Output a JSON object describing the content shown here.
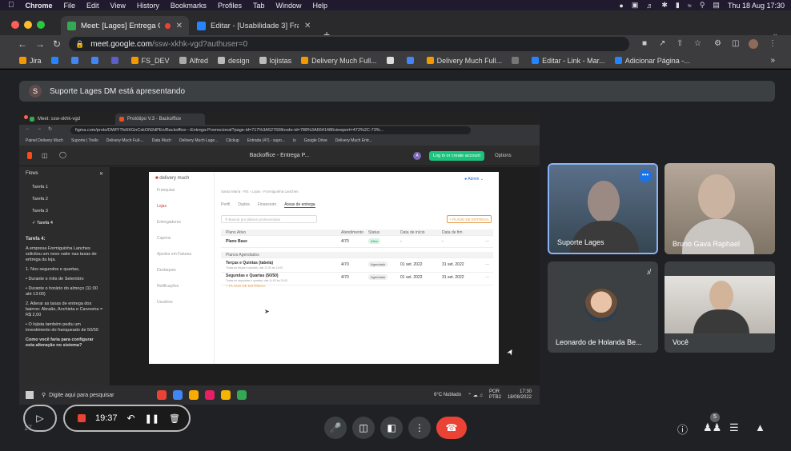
{
  "menubar": {
    "app": "Chrome",
    "items": [
      "File",
      "Edit",
      "View",
      "History",
      "Bookmarks",
      "Profiles",
      "Tab",
      "Window",
      "Help"
    ],
    "clock": "Thu 18 Aug  17:30"
  },
  "browser": {
    "tabs": [
      {
        "label": "Meet: [Lages] Entrega Gra",
        "active": true,
        "color": "#34a853"
      },
      {
        "label": "Editar - [Usabilidade 3] Franqu",
        "active": false,
        "color": "#2684ff"
      }
    ],
    "url_host": "meet.google.com",
    "url_path": "/ssw-xkhk-vgd?authuser=0",
    "bookmarks": [
      {
        "label": "Jira",
        "color": "#f29900"
      },
      {
        "label": "",
        "color": "#2684ff"
      },
      {
        "label": "",
        "color": "#4285f4"
      },
      {
        "label": "",
        "color": "#4285f4"
      },
      {
        "label": "",
        "color": "#5b5fc7"
      },
      {
        "label": "FS_DEV",
        "color": "#f29900"
      },
      {
        "label": "Alfred",
        "color": "#aaaaaa"
      },
      {
        "label": "design",
        "color": "#bbbbbb"
      },
      {
        "label": "lojistas",
        "color": "#bbbbbb"
      },
      {
        "label": "Delivery Much Full...",
        "color": "#f29900"
      },
      {
        "label": "",
        "color": "#dddddd"
      },
      {
        "label": "",
        "color": "#4285f4"
      },
      {
        "label": "Delivery Much Full...",
        "color": "#f29900"
      },
      {
        "label": "",
        "color": "#777777"
      },
      {
        "label": "Editar - Link - Mar...",
        "color": "#2684ff"
      },
      {
        "label": "Adicionar Página -...",
        "color": "#2684ff"
      }
    ]
  },
  "meet": {
    "presenter_initial": "S",
    "presenting_text": "Suporte Lages DM está apresentando",
    "participants": [
      {
        "name": "Suporte Lages",
        "speaking": true
      },
      {
        "name": "Bruno Gava Raphael",
        "speaking": false
      },
      {
        "name": "Leonardo de Holanda Be...",
        "speaking": false,
        "muted": true
      },
      {
        "name": "Você",
        "speaking": false
      }
    ],
    "recording_time": "19:37",
    "participant_count": "5",
    "partial_time": "17"
  },
  "shared_screen": {
    "tabs": [
      "Meet: ssw-xkhk-vgd",
      "Protótipo V.3 - Backoffice"
    ],
    "url": "figma.com/proto/DWfYTfe5KGnCxkON2dPEn/Backoffice---Entrega-Promocional?page-id=717%3A527608node-id=788%3A6641486viewport=472%2C-73%...",
    "bookmarks": [
      "Painel Delivery Much",
      "Suporte | Trello",
      "Delivery Much Full-...",
      "Data Much",
      "Delivery Much Lage...",
      "Clickup",
      "Entrada (47) - supo...",
      "is",
      "Google Drive",
      "Delivery Much Entr..."
    ],
    "figma_title": "Backoffice - Entrega P...",
    "figma_avatar": "A",
    "login_btn": "Log in or create account",
    "options": "Options",
    "flows_title": "Flows",
    "flows": [
      "Tarefa 1",
      "Tarefa 2",
      "Tarefa 3",
      "Tarefa 4"
    ],
    "task_title": "Tarefa 4:",
    "task_paragraphs": [
      "A empresa Formiguinha Lanches solicitou um novo valor nas taxas de entrega da loja.",
      "1. Nos segundos e quartas,",
      "• Durante o mês de Setembro",
      "• Durante o horário do almoço (11:00 até 13:00)",
      "2. Alterar as taxas de entrega dos bairros: Abraão, Anchieta e Carvoeira = R$ 2,00",
      "• O lojista também pediu um investimento do franqueado de 50/50",
      "Como você faria para configurar esta alteração no sistema?"
    ],
    "frame": {
      "logo": "delivery much",
      "admin": "Admin",
      "nav": [
        "Franquias",
        "Lojas",
        "Entregadores",
        "Cupons",
        "Ajustes em Faturas",
        "Destaques",
        "Notificações",
        "Usuários"
      ],
      "breadcrumb": "Santa Maria - RS  ›  Lojas  ›  Formiguinha Lanches",
      "tabs": [
        "Perfil",
        "Dados",
        "Financeiro",
        "Áreas de entrega"
      ],
      "search_placeholder": "Buscar por planos promocionais",
      "add_button": "+ PLANO DE ENTREGA",
      "columns": [
        "Plano Ativo",
        "Atendimento",
        "Status",
        "Data de início",
        "Data de fim"
      ],
      "base_plan": {
        "name": "Plano Base",
        "attendance": "4/70",
        "status": "Ativo",
        "start": "-",
        "end": "-"
      },
      "scheduled_header": "Planos Agendados",
      "scheduled": [
        {
          "name": "Terças e Quintas (tabela)",
          "sub": "Todas as terças e quintas, das 11:00 às 13:00",
          "attendance": "4/70",
          "status": "Agendado",
          "start": "01 set. 2022",
          "end": "31 set. 2022"
        },
        {
          "name": "Segundas e Quartas (50/50)",
          "sub": "Todas as segundas e quartas, das 11:00 às 13:00",
          "attendance": "4/70",
          "status": "Agendado",
          "start": "01 set. 2022",
          "end": "31 set. 2022"
        }
      ],
      "add_plan_link": "+ PLANO DE ENTREGA"
    },
    "taskbar": {
      "search": "Digite aqui para pesquisar",
      "weather": "6°C  Nublado",
      "lang": "POR\nPTB2",
      "time": "17:30",
      "date": "18/08/2022"
    }
  }
}
